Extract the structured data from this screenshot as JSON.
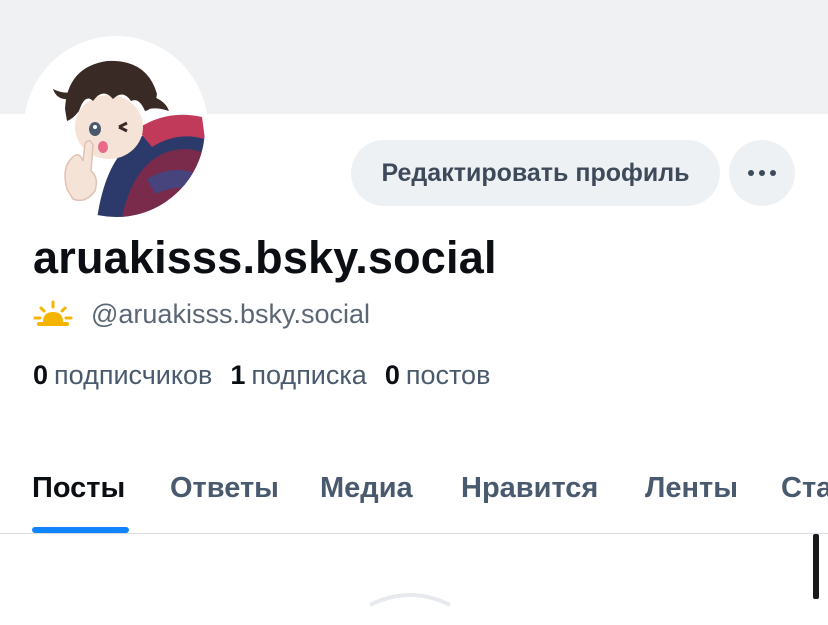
{
  "profile": {
    "display_name": "aruakisss.bsky.social",
    "handle": "@aruakisss.bsky.social",
    "status_icon": "sun-behind-cloud-icon"
  },
  "actions": {
    "edit_profile_label": "Редактировать профиль",
    "more_icon": "ellipsis-icon"
  },
  "stats": {
    "followers_count": "0",
    "followers_label": "подписчиков",
    "following_count": "1",
    "following_label": "подписка",
    "posts_count": "0",
    "posts_label": "постов"
  },
  "tabs": [
    {
      "label": "Посты",
      "active": true
    },
    {
      "label": "Ответы",
      "active": false
    },
    {
      "label": "Медиа",
      "active": false
    },
    {
      "label": "Нравится",
      "active": false
    },
    {
      "label": "Ленты",
      "active": false
    },
    {
      "label": "Ста",
      "active": false
    }
  ],
  "colors": {
    "banner": "#eff1f3",
    "accent": "#1083fe",
    "muted_text": "#4a5a6e",
    "button_bg": "#eef1f4"
  }
}
